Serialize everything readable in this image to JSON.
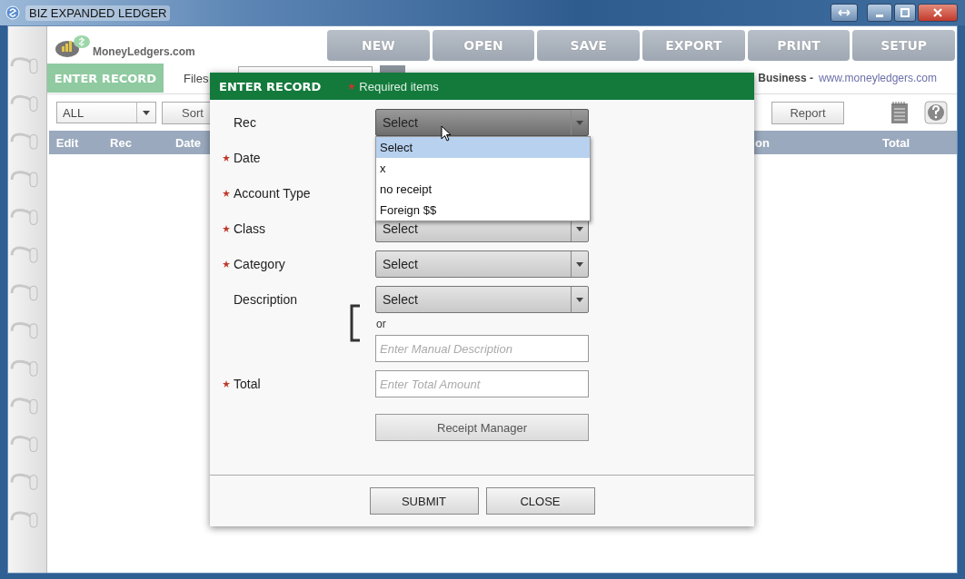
{
  "window": {
    "title": "BIZ EXPANDED LEDGER"
  },
  "logo": {
    "text": "MoneyLedgers.com"
  },
  "nav": [
    "NEW",
    "OPEN",
    "SAVE",
    "EXPORT",
    "PRINT",
    "SETUP"
  ],
  "toolbar": {
    "enter_record": "ENTER RECORD",
    "files_label": "Files",
    "tagline": "Business -",
    "link": "www.moneyledgers.com"
  },
  "filter": {
    "value": "ALL",
    "sort": "Sort",
    "report": "Report"
  },
  "table": {
    "columns": [
      "Edit",
      "Rec",
      "Date",
      "on",
      "Total"
    ]
  },
  "dialog": {
    "title": "ENTER RECORD",
    "note": "Required items",
    "fields": [
      {
        "label": "Rec",
        "required": false,
        "kind": "select",
        "value": "Select",
        "expanded": true,
        "options": [
          {
            "label": "Select",
            "selected": true
          },
          {
            "label": "x",
            "selected": false
          },
          {
            "label": "no receipt",
            "selected": false
          },
          {
            "label": "Foreign $$",
            "selected": false
          }
        ]
      },
      {
        "label": "Date",
        "required": true,
        "kind": "none"
      },
      {
        "label": "Account Type",
        "required": true,
        "kind": "none"
      },
      {
        "label": "Class",
        "required": true,
        "kind": "select",
        "value": "Select",
        "expanded": false
      },
      {
        "label": "Category",
        "required": true,
        "kind": "select",
        "value": "Select",
        "expanded": false
      },
      {
        "label": "Description",
        "required": false,
        "kind": "select-or-text",
        "value": "Select",
        "expanded": false,
        "or": "or",
        "placeholder": "Enter Manual Description"
      },
      {
        "label": "Total",
        "required": true,
        "kind": "text",
        "placeholder": "Enter Total Amount"
      }
    ],
    "receipt_button": "Receipt Manager",
    "buttons": [
      "SUBMIT",
      "CLOSE"
    ]
  }
}
